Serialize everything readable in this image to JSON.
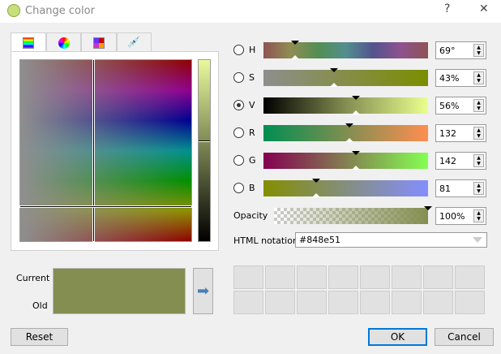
{
  "window": {
    "title": "Change color",
    "help": "?",
    "close": "✕"
  },
  "tabs": [
    {
      "name": "color-ramp"
    },
    {
      "name": "color-wheel"
    },
    {
      "name": "swatches"
    },
    {
      "name": "sample-picker"
    }
  ],
  "channels": [
    {
      "label": "H",
      "value": "69°",
      "fraction": 0.19,
      "gradient": "linear-gradient(to right,#8e5353,#8e8e53,#538e53,#538e8e,#53538e,#8e538e,#8e5353)"
    },
    {
      "label": "S",
      "value": "43%",
      "fraction": 0.43,
      "gradient": "linear-gradient(to right,#8e8e8e,#7a8e00)"
    },
    {
      "label": "V",
      "value": "56%",
      "fraction": 0.56,
      "gradient": "linear-gradient(to right,#000,#848e51,#eaff8f)",
      "selected": true
    },
    {
      "label": "R",
      "value": "132",
      "fraction": 0.52,
      "gradient": "linear-gradient(to right,#008e51,#ff8e51)"
    },
    {
      "label": "G",
      "value": "142",
      "fraction": 0.56,
      "gradient": "linear-gradient(to right,#840051,#84ff51)"
    },
    {
      "label": "B",
      "value": "81",
      "fraction": 0.32,
      "gradient": "linear-gradient(to right,#848e00,#848eff)"
    }
  ],
  "opacity": {
    "label": "Opacity",
    "value": "100%",
    "fraction": 1.0
  },
  "html_notation": {
    "label": "HTML notation",
    "value": "#848e51"
  },
  "preview": {
    "current_label": "Current",
    "old_label": "Old",
    "color": "#848e51"
  },
  "buttons": {
    "reset": "Reset",
    "ok": "OK",
    "cancel": "Cancel"
  }
}
